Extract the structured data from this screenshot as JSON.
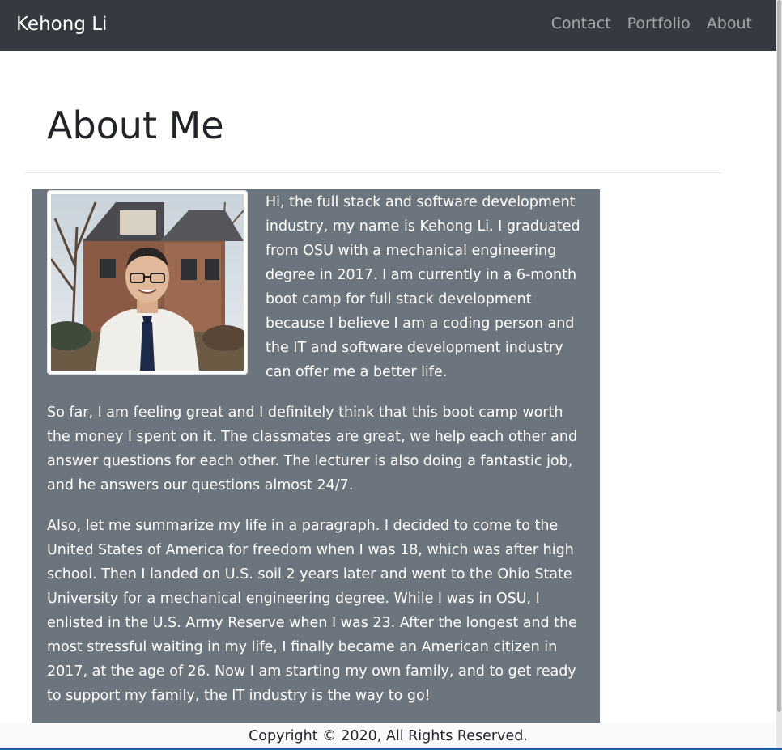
{
  "navbar": {
    "brand": "Kehong Li",
    "links": [
      {
        "label": "Contact"
      },
      {
        "label": "Portfolio"
      },
      {
        "label": "About"
      }
    ]
  },
  "main": {
    "title": "About Me",
    "paragraphs": [
      "Hi, the full stack and software development industry, my name is Kehong Li. I graduated from OSU with a mechanical engineering degree in 2017. I am currently in a 6-month boot camp for full stack development because I believe I am a coding person and the IT and software development industry can offer me a better life.",
      "So far, I am feeling great and I definitely think that this boot camp worth the money I spent on it. The classmates are great, we help each other and answer questions for each other. The lecturer is also doing a fantastic job, and he answers our questions almost 24/7.",
      "Also, let me summarize my life in a paragraph. I decided to come to the United States of America for freedom when I was 18, which was after high school. Then I landed on U.S. soil 2 years later and went to the Ohio State University for a mechanical engineering degree. While I was in OSU, I enlisted in the U.S. Army Reserve when I was 23. After the longest and the most stressful waiting in my life, I finally became an American citizen in 2017, at the age of 26. Now I am starting my own family, and to get ready to support my family, the IT industry is the way to go!"
    ]
  },
  "footer": {
    "text": "Copyright © 2020, All Rights Reserved."
  },
  "colors": {
    "navbar_bg": "#343a40",
    "card_bg": "#6c757d",
    "footer_bg": "#f8f9fa"
  }
}
